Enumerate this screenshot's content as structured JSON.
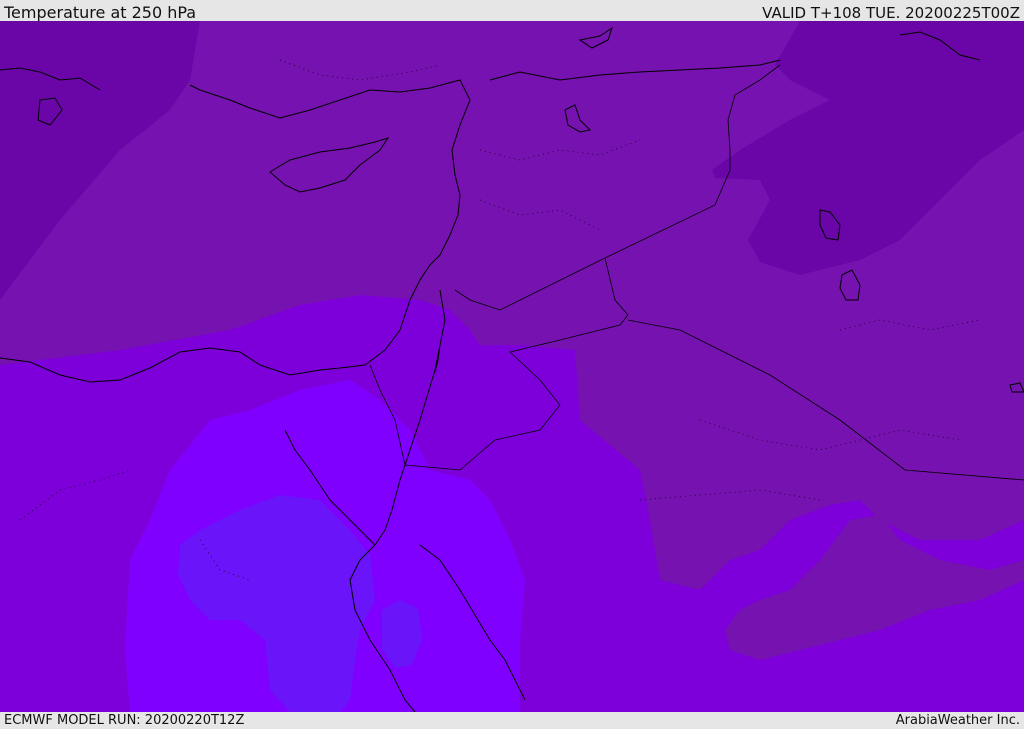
{
  "header": {
    "title": "Temperature at 250 hPa",
    "valid": "VALID T+108 TUE. 20200225T00Z"
  },
  "footer": {
    "model_run": "ECMWF MODEL RUN: 20200220T12Z",
    "brand": "ArabiaWeather Inc."
  },
  "map": {
    "colors": {
      "band_cold_dark": "#6a06a8",
      "band_mid": "#7612b0",
      "band_warm": "#7d00db",
      "band_warmer": "#8000ff",
      "band_warmest": "#6a14fa",
      "coastline": "#000000",
      "border": "#000000"
    }
  }
}
